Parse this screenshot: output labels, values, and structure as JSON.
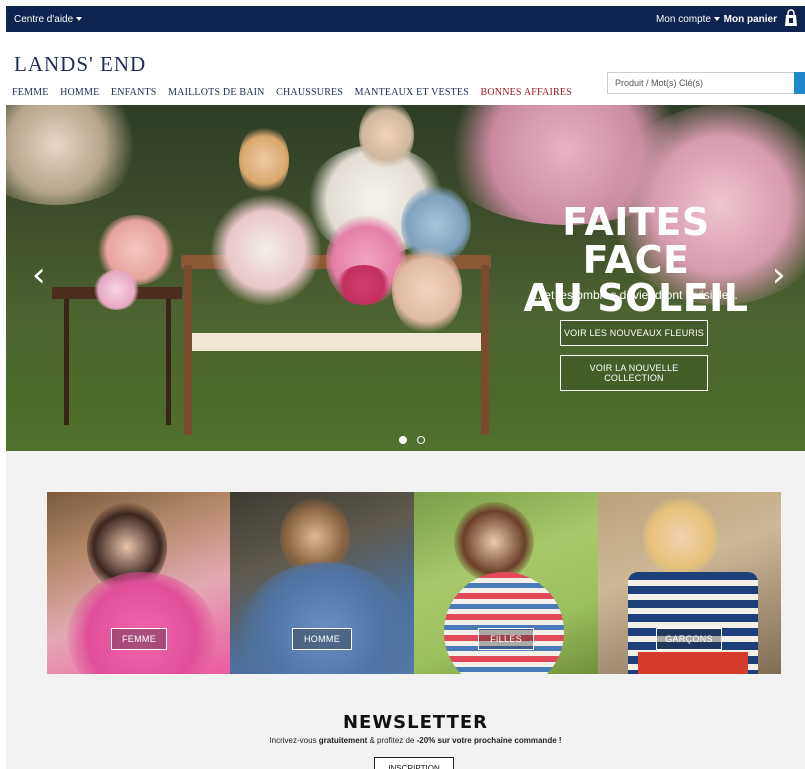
{
  "topbar": {
    "help_label": "Centre d'aide",
    "account_label": "Mon compte",
    "cart_label": "Mon panier"
  },
  "header": {
    "logo": "LANDS' END",
    "nav": [
      "FEMME",
      "HOMME",
      "ENFANTS",
      "MAILLOTS DE BAIN",
      "CHAUSSURES",
      "MANTEAUX ET VESTES",
      "BONNES AFFAIRES"
    ],
    "search_placeholder": "Produit / Mot(s) Clé(s)"
  },
  "hero": {
    "title_line1": "FAITES FACE",
    "title_line2": "AU SOLEIL",
    "subtitle": "...et les ombres deviendront invisibles.",
    "btn_fleuris": "VOIR LES NOUVEAUX FLEURIS",
    "btn_collection": "VOIR LA NOUVELLE COLLECTION",
    "slide_count": 2,
    "active_slide": 1
  },
  "categories": [
    {
      "label": "FEMME"
    },
    {
      "label": "HOMME"
    },
    {
      "label": "FILLES"
    },
    {
      "label": "GARÇONS"
    }
  ],
  "newsletter": {
    "title": "NEWSLETTER",
    "text_pre": "Incrivez-vous ",
    "text_bold1": "gratuitement",
    "text_mid": " & profitez de ",
    "text_bold2": "-20% sur votre prochaine commande !",
    "button": "INSCRIPTION"
  },
  "colors": {
    "topbar": "#0e2350",
    "brand_navy": "#1c2d5a",
    "sale_red": "#a31c1c",
    "search_blue": "#1e88c8"
  }
}
